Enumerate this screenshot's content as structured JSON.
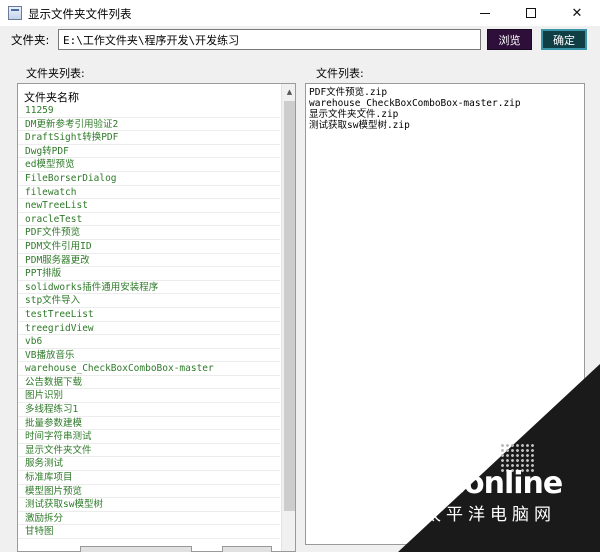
{
  "window": {
    "title": "显示文件夹文件列表",
    "minimize": "—",
    "close": "✕"
  },
  "toolbar": {
    "folder_label": "文件夹:",
    "path_value": "E:\\工作文件夹\\程序开发\\开发练习",
    "browse_label": "浏览",
    "ok_label": "确定",
    "browse_color": "#2e0f3a",
    "ok_color": "#0f3f44"
  },
  "folder_list": {
    "label": "文件夹列表:",
    "column_header": "文件夹名称",
    "items": [
      "11259",
      "DM更新参考引用验证2",
      "DraftSight转换PDF",
      "Dwg转PDF",
      "ed模型预览",
      "FileBorserDialog",
      "filewatch",
      "newTreeList",
      "oracleTest",
      "PDF文件预览",
      "PDM文件引用ID",
      "PDM服务器更改",
      "PPT排版",
      "solidworks插件通用安装程序",
      "stp文件导入",
      "testTreeList",
      "treegridView",
      "vb6",
      "VB播放音乐",
      "warehouse_CheckBoxComboBox-master",
      "公告数据下载",
      "图片识别",
      "多线程练习1",
      "批量参数建模",
      "时间字符串测试",
      "显示文件夹文件",
      "服务测试",
      "标准库项目",
      "模型图片预览",
      "测试获取sw模型树",
      "激励拆分",
      "甘特图"
    ],
    "item_color": "#2f7a2a"
  },
  "file_list": {
    "label": "文件列表:",
    "items": [
      "PDF文件预览.zip",
      "warehouse_CheckBoxComboBox-master.zip",
      "显示文件夹文件.zip",
      "测试获取sw模型树.zip"
    ]
  },
  "watermark": {
    "logo": "PConline",
    "subtitle": "太平洋电脑网"
  }
}
